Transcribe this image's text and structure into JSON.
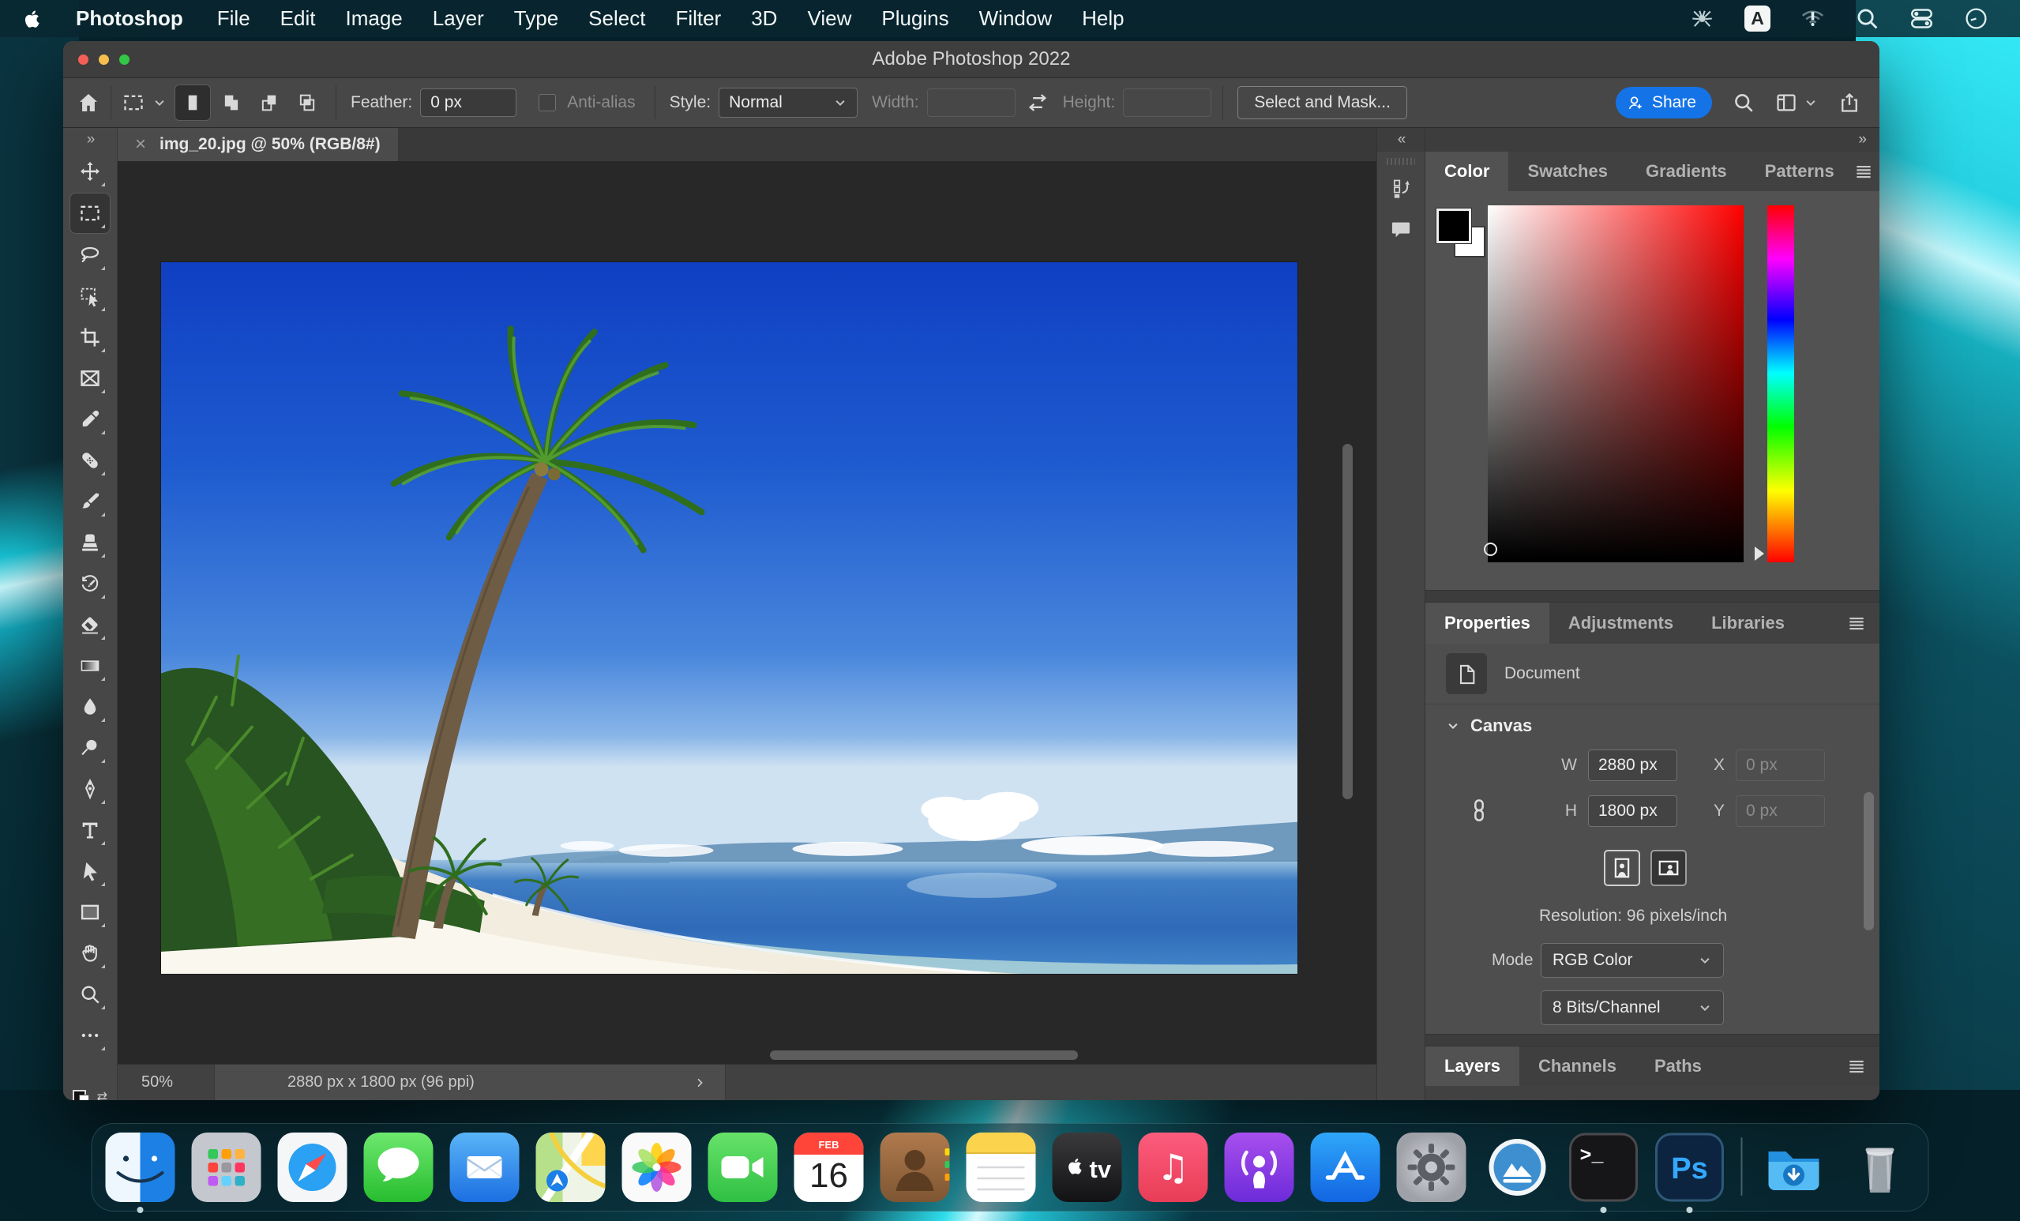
{
  "colors": {
    "accent_blue": "#1473e6",
    "menu_bar_teal": "#0b2f3a",
    "traffic_red": "#f35f57",
    "traffic_yellow": "#f6be4f",
    "traffic_green": "#32c846",
    "photoshop_ps_blue": "#34a8ff"
  },
  "menu_bar": {
    "apple_icon": "apple-icon",
    "items": [
      "Photoshop",
      "File",
      "Edit",
      "Image",
      "Layer",
      "Type",
      "Select",
      "Filter",
      "3D",
      "View",
      "Plugins",
      "Window",
      "Help"
    ],
    "status_icons": [
      "antivirus-spider-icon",
      "keyboard-layout-icon",
      "wifi-alert-icon",
      "spotlight-search-icon",
      "control-center-icon",
      "clock-icon"
    ],
    "keyboard_layout_label": "A"
  },
  "window": {
    "title": "Adobe Photoshop 2022",
    "options_bar": {
      "home_icon": "home-icon",
      "tool_preset_icon": "marquee-preset-icon",
      "selection_mode_icons": [
        "new-selection-icon",
        "add-selection-icon",
        "subtract-selection-icon",
        "intersect-selection-icon"
      ],
      "feather_label": "Feather:",
      "feather_value": "0 px",
      "anti_alias_label": "Anti-alias",
      "style_label": "Style:",
      "style_value": "Normal",
      "width_label": "Width:",
      "width_value": "",
      "swap_icon": "swap-dimensions-icon",
      "height_label": "Height:",
      "height_value": "",
      "select_and_mask_label": "Select and Mask...",
      "share_label": "Share",
      "right_icons": [
        "search-icon",
        "workspace-switcher-icon",
        "export-icon"
      ]
    },
    "document_tab": {
      "label": "img_20.jpg @ 50% (RGB/8#)",
      "close_icon": "close-icon"
    },
    "tools": [
      {
        "name": "move-tool",
        "icon": "move"
      },
      {
        "name": "rectangular-marquee-tool",
        "icon": "marquee",
        "selected": true
      },
      {
        "name": "lasso-tool",
        "icon": "lasso"
      },
      {
        "name": "object-selection-tool",
        "icon": "objectSelect"
      },
      {
        "name": "crop-tool",
        "icon": "crop"
      },
      {
        "name": "frame-tool",
        "icon": "frame"
      },
      {
        "name": "eyedropper-tool",
        "icon": "eyedropper"
      },
      {
        "name": "spot-healing-brush-tool",
        "icon": "healing"
      },
      {
        "name": "brush-tool",
        "icon": "brush"
      },
      {
        "name": "clone-stamp-tool",
        "icon": "clone"
      },
      {
        "name": "history-brush-tool",
        "icon": "historyBrush"
      },
      {
        "name": "eraser-tool",
        "icon": "eraser"
      },
      {
        "name": "gradient-tool",
        "icon": "gradient"
      },
      {
        "name": "blur-tool",
        "icon": "blur"
      },
      {
        "name": "dodge-tool",
        "icon": "dodge"
      },
      {
        "name": "pen-tool",
        "icon": "pen"
      },
      {
        "name": "type-tool",
        "icon": "type"
      },
      {
        "name": "path-selection-tool",
        "icon": "pathSelect"
      },
      {
        "name": "rectangle-tool",
        "icon": "rectangle"
      },
      {
        "name": "hand-tool",
        "icon": "hand"
      },
      {
        "name": "zoom-tool",
        "icon": "zoom"
      },
      {
        "name": "edit-toolbar",
        "icon": "ellipsis"
      }
    ],
    "panel_strip_icons": [
      "history-panel-icon",
      "comments-panel-icon"
    ],
    "panels": {
      "color": {
        "tabs": [
          "Color",
          "Swatches",
          "Gradients",
          "Patterns"
        ],
        "active_tab": "Color"
      },
      "properties": {
        "tabs": [
          "Properties",
          "Adjustments",
          "Libraries"
        ],
        "active_tab": "Properties",
        "document_label": "Document",
        "canvas_section": {
          "title": "Canvas",
          "w_label": "W",
          "w_value": "2880 px",
          "x_label": "X",
          "x_value": "0 px",
          "h_label": "H",
          "h_value": "1800 px",
          "y_label": "Y",
          "y_value": "0 px"
        },
        "resolution_text": "Resolution: 96 pixels/inch",
        "mode_label": "Mode",
        "mode_value": "RGB Color",
        "depth_value": "8 Bits/Channel"
      },
      "layers": {
        "tabs": [
          "Layers",
          "Channels",
          "Paths"
        ],
        "active_tab": "Layers"
      }
    },
    "status_bar": {
      "zoom_level": "50%",
      "dimensions": "2880 px x 1800 px (96 ppi)"
    }
  },
  "dock": {
    "items": [
      {
        "name": "finder",
        "running": true
      },
      {
        "name": "launchpad"
      },
      {
        "name": "safari"
      },
      {
        "name": "messages"
      },
      {
        "name": "mail"
      },
      {
        "name": "maps"
      },
      {
        "name": "photos"
      },
      {
        "name": "facetime"
      },
      {
        "name": "calendar",
        "month": "FEB",
        "day": "16"
      },
      {
        "name": "contacts"
      },
      {
        "name": "notes"
      },
      {
        "name": "apple-tv",
        "label": "tv"
      },
      {
        "name": "music"
      },
      {
        "name": "podcasts"
      },
      {
        "name": "app-store"
      },
      {
        "name": "system-preferences"
      },
      {
        "name": "app-cleaner"
      },
      {
        "name": "terminal",
        "label": "&gt;_",
        "running": true
      },
      {
        "name": "photoshop",
        "label": "Ps",
        "running": true
      },
      {
        "name": "divider"
      },
      {
        "name": "downloads"
      },
      {
        "name": "trash"
      }
    ]
  }
}
